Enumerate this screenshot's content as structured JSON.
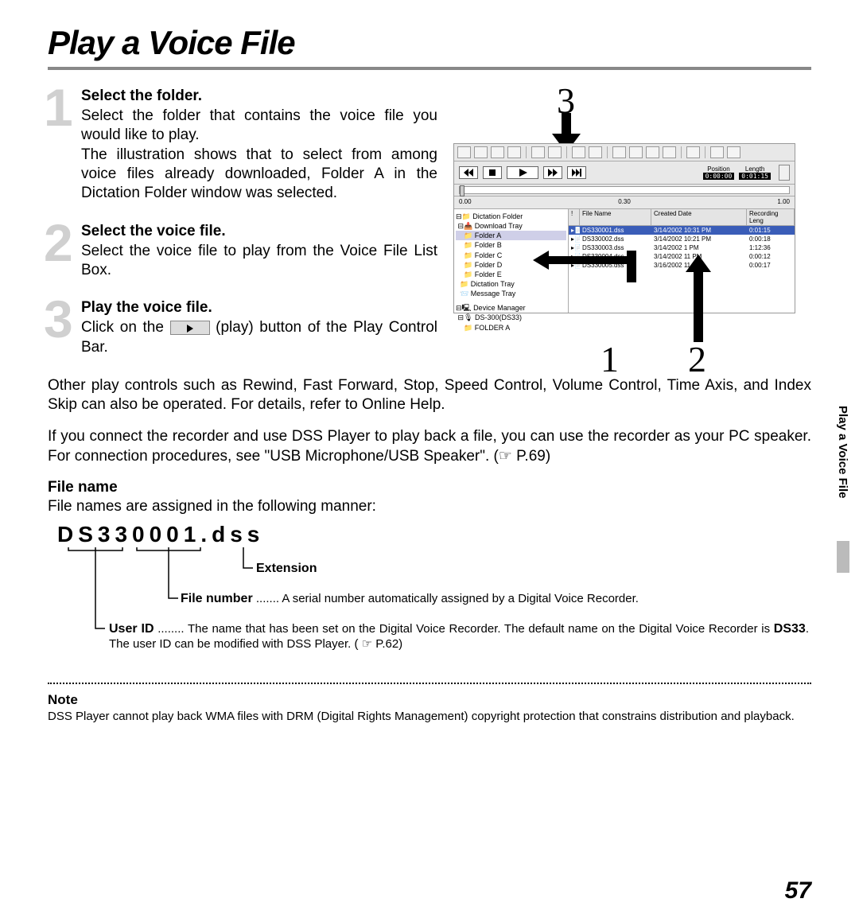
{
  "title": "Play a Voice File",
  "steps": [
    {
      "num": "1",
      "title": "Select the folder.",
      "body1": "Select the folder that contains the voice file you would like to play.",
      "body2": "The illustration shows that to select from among voice files already downloaded, Folder A in the Dictation Folder window was selected."
    },
    {
      "num": "2",
      "title": "Select the voice file.",
      "body1": "Select the voice file to play from the Voice File List Box."
    },
    {
      "num": "3",
      "title": "Play the voice file.",
      "body_pre": "Click on the ",
      "body_post": " (play) button of the Play Control Bar."
    }
  ],
  "para1": "Other play controls such as Rewind, Fast Forward, Stop, Speed Control, Volume Control, Time Axis, and Index Skip can also be operated. For details, refer to Online Help.",
  "para2": "If you connect the recorder and use DSS Player to play back a file, you can use the recorder as your PC speaker.  For connection procedures, see \"USB Microphone/USB Speaker\". (☞ P.69)",
  "filename_section": {
    "heading": "File name",
    "intro": "File names are assigned in the following manner:",
    "example": "DS330001.dss",
    "extension_label": "Extension",
    "filenumber_label": "File number",
    "filenumber_desc": " ....... A serial number automatically assigned by a Digital Voice Recorder.",
    "userid_label": "User ID",
    "userid_desc_pre": " ........ The name that has been set on the Digital Voice Recorder. The default name on the Digital Voice Recorder is ",
    "userid_bold": "DS33",
    "userid_desc_post": ". The user ID can be modified with DSS Player. ( ☞ P.62)"
  },
  "note": {
    "heading": "Note",
    "body": "DSS Player cannot play back WMA files with DRM (Digital Rights Management) copyright protection that constrains distribution and playback."
  },
  "page_number": "57",
  "side_tab": "Play a Voice File",
  "screenshot": {
    "position_label": "Position",
    "length_label": "Length",
    "position_value": "0:00:00",
    "length_value": "0:01:15",
    "ruler": [
      "0.00",
      "0.30",
      "1.00"
    ],
    "tree": {
      "root": "Dictation Folder",
      "download": "Download Tray",
      "folders": [
        "Folder A",
        "Folder B",
        "Folder C",
        "Folder D",
        "Folder E"
      ],
      "dictation_tray": "Dictation Tray",
      "message_tray": "Message Tray",
      "device_mgr": "Device Manager",
      "device": "DS-300(DS33)",
      "device_folder": "FOLDER A"
    },
    "list": {
      "headers": [
        "!",
        "File Name",
        "Created Date",
        "Recording Leng"
      ],
      "rows": [
        {
          "name": "DS330001.dss",
          "date": "3/14/2002 10:31 PM",
          "len": "0:01:15",
          "sel": true
        },
        {
          "name": "DS330002.dss",
          "date": "3/14/2002 10:21 PM",
          "len": "0:00:18"
        },
        {
          "name": "DS330003.dss",
          "date": "3/14/2002 1     PM",
          "len": "1:12:36"
        },
        {
          "name": "DS330004.dss",
          "date": "3/14/2002 11    PM",
          "len": "0:00:12"
        },
        {
          "name": "DS330005.dss",
          "date": "3/16/2002 11    PM",
          "len": "0:00:17"
        }
      ]
    },
    "callouts": {
      "top": "3",
      "left": "1",
      "right": "2"
    }
  }
}
